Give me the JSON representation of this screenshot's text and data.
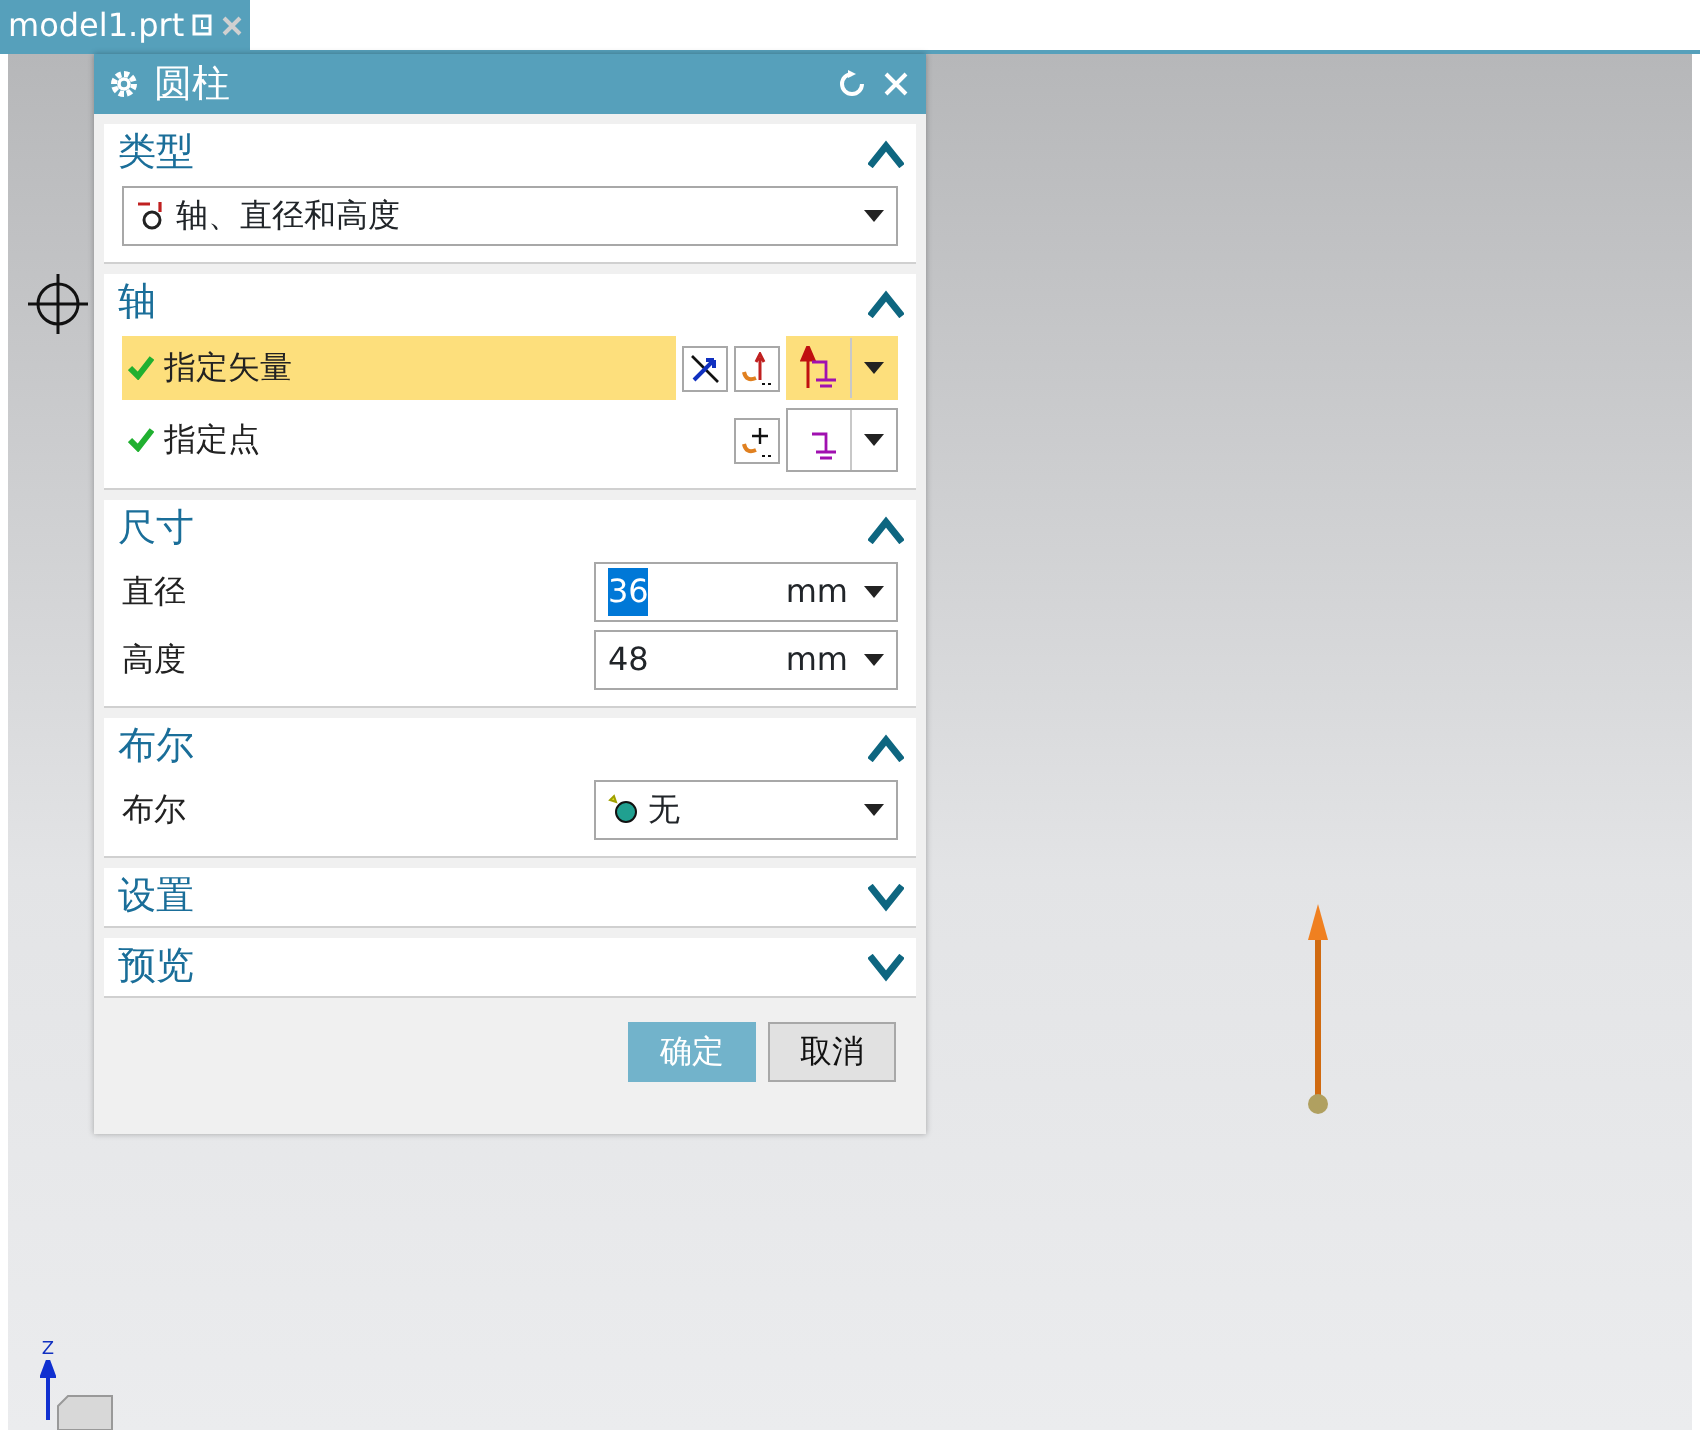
{
  "tab": {
    "title": "model1.prt",
    "selected": true
  },
  "dialog": {
    "title": "圆柱",
    "sections": [
      {
        "title": "类型",
        "expanded": true,
        "rows": [
          {
            "kind": "type",
            "value": "轴、直径和高度"
          }
        ]
      },
      {
        "title": "轴",
        "expanded": true,
        "rows": [
          {
            "kind": "selector",
            "label": "指定矢量",
            "checked": true,
            "selected": true
          },
          {
            "kind": "selector",
            "label": "指定点",
            "checked": true,
            "selected": false
          }
        ]
      },
      {
        "title": "尺寸",
        "expanded": true,
        "rows": [
          {
            "kind": "number",
            "label": "直径",
            "value": "36",
            "unit": "mm",
            "selected": true
          },
          {
            "kind": "number",
            "label": "高度",
            "value": "48",
            "unit": "mm",
            "selected": false
          }
        ]
      },
      {
        "title": "布尔",
        "expanded": true,
        "rows": [
          {
            "kind": "boolean",
            "label": "布尔",
            "value": "无"
          }
        ]
      },
      {
        "title": "设置",
        "expanded": false
      },
      {
        "title": "预览",
        "expanded": false
      }
    ],
    "buttons": [
      {
        "label": "确定",
        "kind": "primary"
      },
      {
        "label": "取消",
        "kind": "secondary"
      }
    ]
  },
  "axis_label": "Z"
}
